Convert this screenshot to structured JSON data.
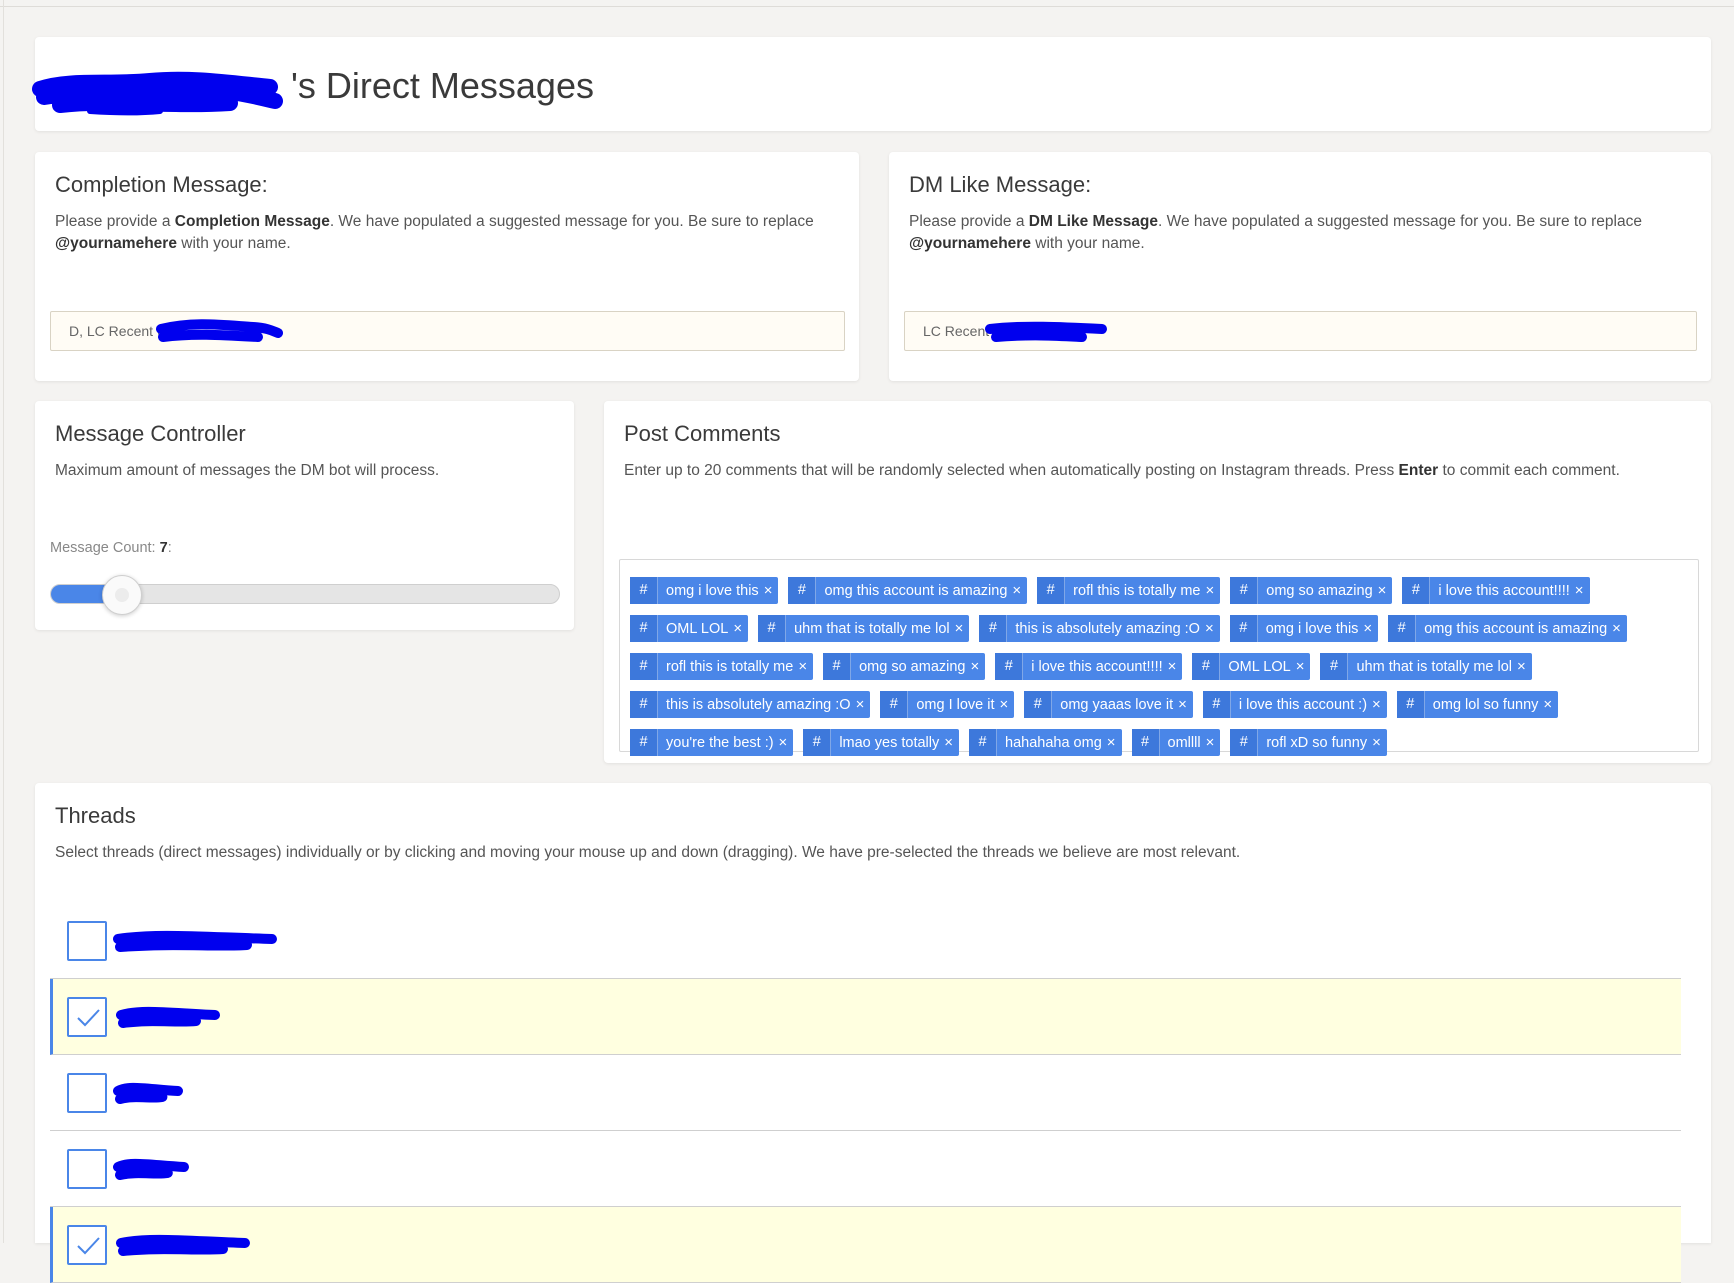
{
  "page": {
    "title": "'s Direct Messages"
  },
  "completion": {
    "heading": "Completion Message:",
    "desc_prefix": "Please provide a ",
    "desc_bold": "Completion Message",
    "desc_mid": ". We have populated a suggested message for you. Be sure to replace ",
    "desc_handle": "@yournamehere",
    "desc_suffix": " with your name.",
    "value": "D, LC Recent @"
  },
  "dm_like": {
    "heading": "DM Like Message:",
    "desc_prefix": "Please provide a ",
    "desc_bold": "DM Like Message",
    "desc_mid": ". We have populated a suggested message for you. Be sure to replace ",
    "desc_handle": "@yournamehere",
    "desc_suffix": " with your name.",
    "value": "LC Recent"
  },
  "controller": {
    "heading": "Message Controller",
    "desc": "Maximum amount of messages the DM bot will process.",
    "count_label": "Message Count: ",
    "count_value": "7",
    "count_suffix": ":",
    "slider_fraction": 0.14
  },
  "comments": {
    "heading": "Post Comments",
    "desc_prefix": "Enter up to 20 comments that will be randomly selected when automatically posting on Instagram threads. Press ",
    "desc_bold": "Enter",
    "desc_suffix": " to commit each comment.",
    "hash_symbol": "#",
    "remove_symbol": "×",
    "tags": [
      "omg i love this",
      "omg this account is amazing",
      "rofl this is totally me",
      "omg so amazing",
      "i love this account!!!!",
      "OML LOL",
      "uhm that is totally me lol",
      "this is absolutely amazing :O",
      "omg i love this",
      "omg this account is amazing",
      "rofl this is totally me",
      "omg so amazing",
      "i love this account!!!!",
      "OML LOL",
      "uhm that is totally me lol",
      "this is absolutely amazing :O",
      "omg I love it",
      "omg yaaas love it",
      "i love this account :)",
      "omg lol so funny",
      "you're the best :)",
      "lmao yes totally",
      "hahahaha omg",
      "omllll",
      "rofl xD so funny"
    ]
  },
  "threads": {
    "heading": "Threads",
    "desc": "Select threads (direct messages) individually or by clicking and moving your mouse up and down (dragging). We have pre-selected the threads we believe are most relevant.",
    "items": [
      {
        "selected": false
      },
      {
        "selected": true
      },
      {
        "selected": false
      },
      {
        "selected": false
      },
      {
        "selected": true
      }
    ]
  },
  "colors": {
    "accent": "#4a86e8",
    "selected_row": "#ffffe0",
    "redaction": "#0000ee"
  }
}
